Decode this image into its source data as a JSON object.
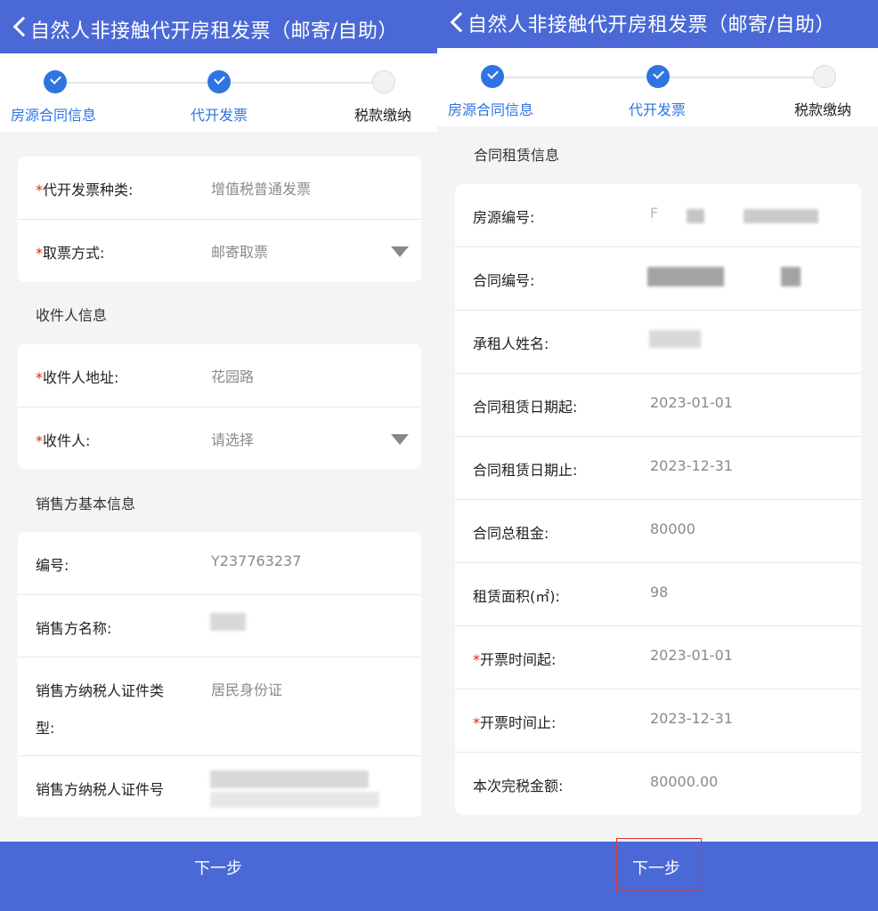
{
  "header": {
    "title": "自然人非接触代开房租发票（邮寄/自助）"
  },
  "steps": [
    {
      "label": "房源合同信息",
      "status": "done"
    },
    {
      "label": "代开发票",
      "status": "done"
    },
    {
      "label": "税款缴纳",
      "status": "todo"
    }
  ],
  "required_mark": "*",
  "left": {
    "invoice_card": {
      "invoice_type": {
        "label": "代开发票种类:",
        "value": "增值税普通发票"
      },
      "pickup_method": {
        "label": "取票方式:",
        "value": "邮寄取票"
      }
    },
    "recipient_section_title": "收件人信息",
    "recipient_card": {
      "address": {
        "label": "收件人地址:",
        "value": "花园路"
      },
      "recipient": {
        "label": "收件人:",
        "placeholder": "请选择"
      }
    },
    "seller_section_title": "销售方基本信息",
    "seller_card": {
      "number": {
        "label": "编号:",
        "value": "Y237763237"
      },
      "name": {
        "label": "销售方名称:"
      },
      "id_type": {
        "label_line1": "销售方纳税人证件类",
        "label_line2": "型:",
        "value": "居民身份证"
      },
      "id_number": {
        "label": "销售方纳税人证件号"
      }
    }
  },
  "right": {
    "section_title": "合同租赁信息",
    "contract_card": {
      "property_no": {
        "label": "房源编号:",
        "value_prefix": "F"
      },
      "contract_no": {
        "label": "合同编号:"
      },
      "tenant_name": {
        "label": "承租人姓名:"
      },
      "lease_start": {
        "label": "合同租赁日期起:",
        "value": "2023-01-01"
      },
      "lease_end": {
        "label": "合同租赁日期止:",
        "value": "2023-12-31"
      },
      "total_rent": {
        "label": "合同总租金:",
        "value": "80000"
      },
      "area": {
        "label": "租赁面积(㎡):",
        "value": "98"
      },
      "invoice_start": {
        "label": "开票时间起:",
        "value": "2023-01-01"
      },
      "invoice_end": {
        "label": "开票时间止:",
        "value": "2023-12-31"
      },
      "tax_amount": {
        "label": "本次完税金额:",
        "value": "80000.00"
      }
    }
  },
  "bottom": {
    "next_label": "下一步"
  },
  "colors": {
    "primary": "#4a69d6",
    "step_done": "#2f74e0",
    "required": "#d9261c",
    "highlight": "#e3342f"
  }
}
